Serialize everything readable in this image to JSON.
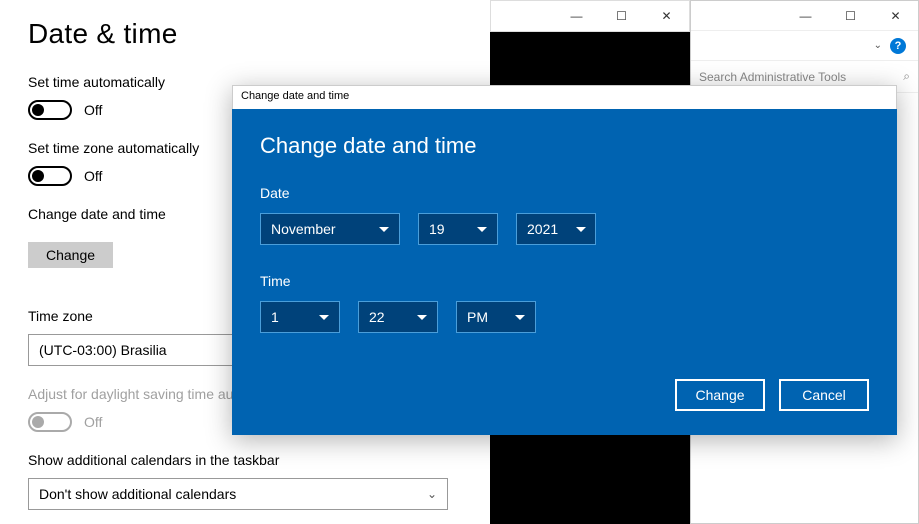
{
  "settings": {
    "page_title": "Date & time",
    "auto_time": {
      "label": "Set time automatically",
      "state_text": "Off"
    },
    "auto_tz": {
      "label": "Set time zone automatically",
      "state_text": "Off"
    },
    "change_section": {
      "label": "Change date and time",
      "button": "Change"
    },
    "timezone": {
      "label": "Time zone",
      "value": "(UTC-03:00) Brasilia"
    },
    "dst": {
      "label": "Adjust for daylight saving time automatically",
      "state_text": "Off"
    },
    "add_cal": {
      "label": "Show additional calendars in the taskbar",
      "value": "Don't show additional calendars"
    }
  },
  "bg_window2": {
    "search_placeholder": "Search Administrative Tools"
  },
  "dialog": {
    "titlebar": "Change date and time",
    "heading": "Change date and time",
    "date_label": "Date",
    "time_label": "Time",
    "month": "November",
    "day": "19",
    "year": "2021",
    "hour": "1",
    "minute": "22",
    "ampm": "PM",
    "change_btn": "Change",
    "cancel_btn": "Cancel"
  }
}
